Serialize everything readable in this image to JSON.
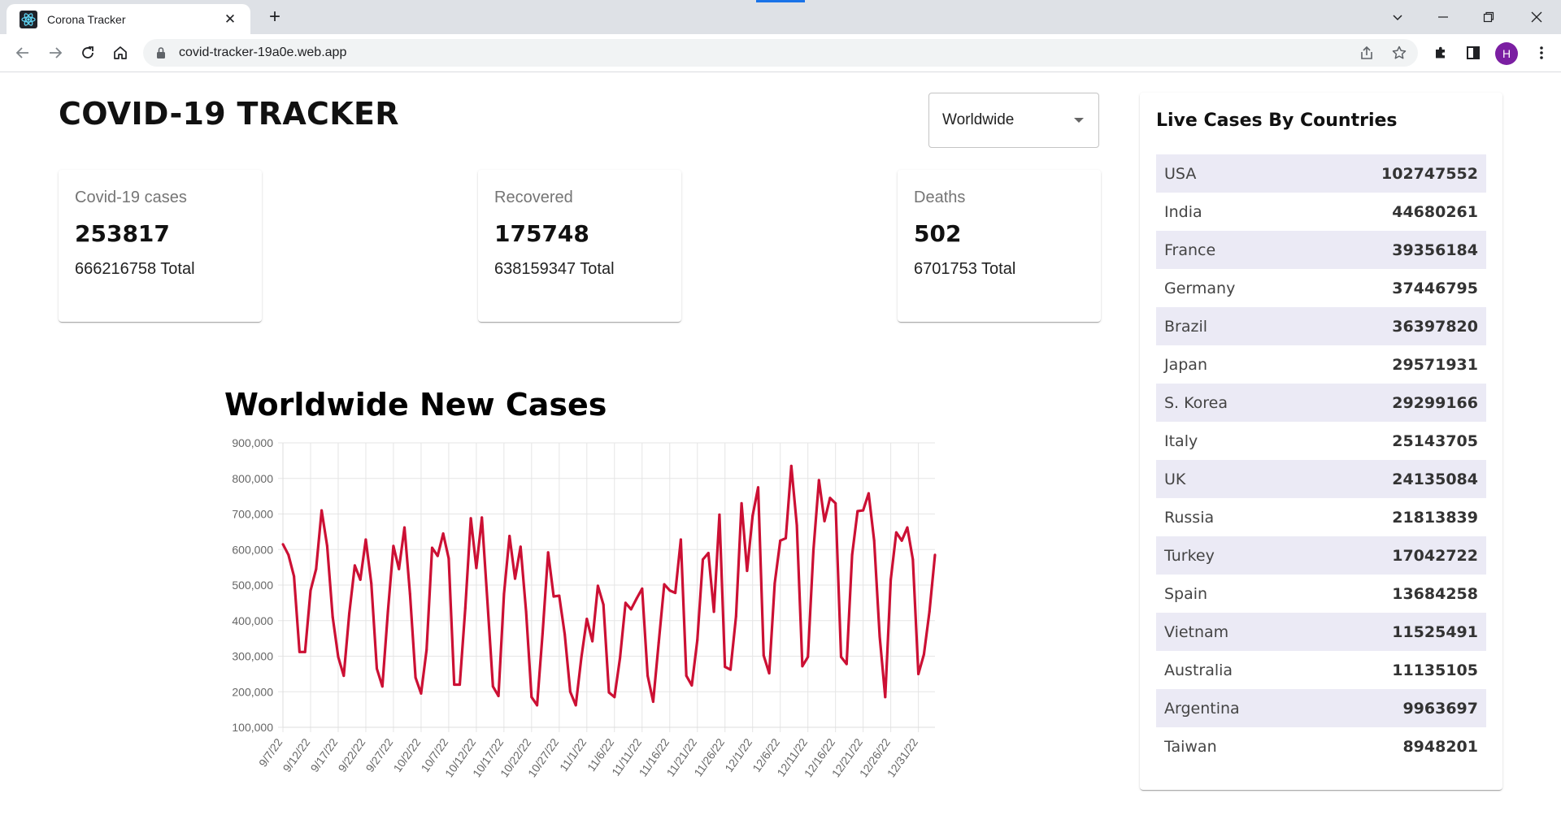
{
  "browser": {
    "tab_title": "Corona Tracker",
    "tab_close": "✕",
    "new_tab": "+",
    "url": "covid-tracker-19a0e.web.app",
    "profile_initial": "H"
  },
  "app": {
    "title": "COVID-19 TRACKER",
    "country_select": {
      "value": "Worldwide"
    }
  },
  "cards": [
    {
      "label": "Covid-19 cases",
      "cases": "253817",
      "total": "666216758 Total"
    },
    {
      "label": "Recovered",
      "cases": "175748",
      "total": "638159347 Total"
    },
    {
      "label": "Deaths",
      "cases": "502",
      "total": "6701753 Total"
    }
  ],
  "live": {
    "title": "Live Cases By Countries",
    "rows": [
      {
        "country": "USA",
        "cases": "102747552"
      },
      {
        "country": "India",
        "cases": "44680261"
      },
      {
        "country": "France",
        "cases": "39356184"
      },
      {
        "country": "Germany",
        "cases": "37446795"
      },
      {
        "country": "Brazil",
        "cases": "36397820"
      },
      {
        "country": "Japan",
        "cases": "29571931"
      },
      {
        "country": "S. Korea",
        "cases": "29299166"
      },
      {
        "country": "Italy",
        "cases": "25143705"
      },
      {
        "country": "UK",
        "cases": "24135084"
      },
      {
        "country": "Russia",
        "cases": "21813839"
      },
      {
        "country": "Turkey",
        "cases": "17042722"
      },
      {
        "country": "Spain",
        "cases": "13684258"
      },
      {
        "country": "Vietnam",
        "cases": "11525491"
      },
      {
        "country": "Australia",
        "cases": "11135105"
      },
      {
        "country": "Argentina",
        "cases": "9963697"
      },
      {
        "country": "Taiwan",
        "cases": "8948201"
      }
    ]
  },
  "chart": {
    "title": "Worldwide New Cases"
  },
  "colors": {
    "line": "#cc1034",
    "grid": "#e5e5e5",
    "row_stripe": "#ebeaf5",
    "avatar": "#7b1fa2"
  },
  "chart_data": {
    "type": "line",
    "title": "Worldwide New Cases",
    "xlabel": "",
    "ylabel": "",
    "ylim": [
      100000,
      900000
    ],
    "yticks": [
      "900,000",
      "800,000",
      "700,000",
      "600,000",
      "500,000",
      "400,000",
      "300,000",
      "200,000",
      "100,000"
    ],
    "xticks": [
      "9/7/22",
      "9/12/22",
      "9/17/22",
      "9/22/22",
      "9/27/22",
      "10/2/22",
      "10/7/22",
      "10/12/22",
      "10/17/22",
      "10/22/22",
      "10/27/22",
      "11/1/22",
      "11/6/22",
      "11/11/22",
      "11/16/22",
      "11/21/22",
      "11/26/22",
      "12/1/22",
      "12/6/22",
      "12/11/22",
      "12/16/22",
      "12/21/22",
      "12/26/22",
      "12/31/22"
    ],
    "grid": true,
    "legend": "none",
    "series": [
      {
        "color": "#cc1034",
        "values": [
          615000,
          585000,
          525000,
          312000,
          312000,
          485000,
          545000,
          710000,
          610000,
          410000,
          298000,
          245000,
          420000,
          555000,
          515000,
          628000,
          505000,
          265000,
          215000,
          425000,
          610000,
          545000,
          662000,
          475000,
          240000,
          195000,
          318000,
          605000,
          582000,
          645000,
          575000,
          220000,
          220000,
          435000,
          688000,
          548000,
          690000,
          455000,
          215000,
          188000,
          475000,
          638000,
          518000,
          608000,
          425000,
          185000,
          162000,
          365000,
          592000,
          468000,
          470000,
          362000,
          200000,
          162000,
          295000,
          405000,
          342000,
          498000,
          445000,
          198000,
          185000,
          295000,
          450000,
          432000,
          462000,
          490000,
          245000,
          172000,
          338000,
          502000,
          485000,
          478000,
          628000,
          245000,
          218000,
          345000,
          572000,
          590000,
          425000,
          698000,
          270000,
          262000,
          412000,
          730000,
          540000,
          695000,
          775000,
          302000,
          252000,
          505000,
          625000,
          632000,
          835000,
          668000,
          272000,
          298000,
          598000,
          795000,
          680000,
          745000,
          730000,
          298000,
          278000,
          585000,
          708000,
          710000,
          758000,
          625000,
          355000,
          185000,
          515000,
          648000,
          625000,
          662000,
          572000,
          250000,
          305000,
          425000,
          585000
        ]
      }
    ]
  }
}
